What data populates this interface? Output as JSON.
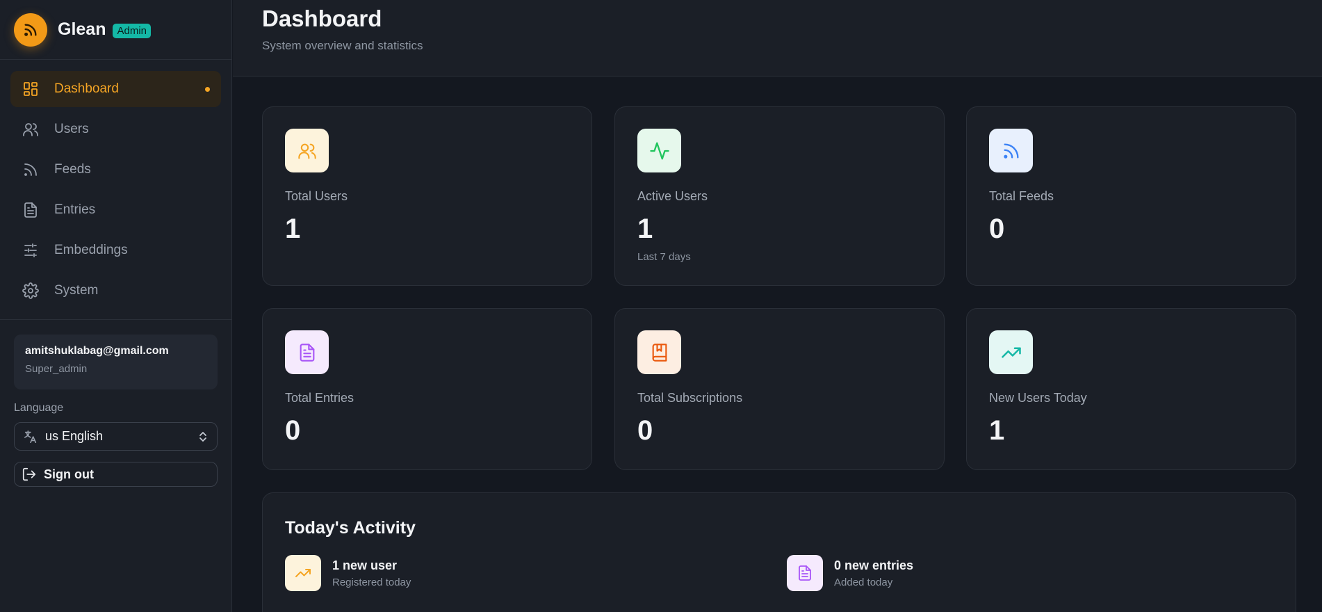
{
  "brand": {
    "name": "Glean",
    "badge": "Admin",
    "logo_icon": "rss-icon",
    "accent": "#f39a17"
  },
  "nav": {
    "items": [
      {
        "label": "Dashboard",
        "icon": "grid-icon",
        "active": true
      },
      {
        "label": "Users",
        "icon": "users-icon",
        "active": false
      },
      {
        "label": "Feeds",
        "icon": "rss-icon",
        "active": false
      },
      {
        "label": "Entries",
        "icon": "document-icon",
        "active": false
      },
      {
        "label": "Embeddings",
        "icon": "sliders-icon",
        "active": false
      },
      {
        "label": "System",
        "icon": "gear-icon",
        "active": false
      }
    ]
  },
  "user": {
    "email": "amitshuklabag@gmail.com",
    "role": "Super_admin"
  },
  "language": {
    "label": "Language",
    "value": "us English"
  },
  "signout": {
    "label": "Sign out"
  },
  "header": {
    "title": "Dashboard",
    "subtitle": "System overview and statistics"
  },
  "stats": [
    {
      "label": "Total Users",
      "value": "1",
      "note": "",
      "icon": "users-icon",
      "color": "#f5a524"
    },
    {
      "label": "Active Users",
      "value": "1",
      "note": "Last 7 days",
      "icon": "activity-icon",
      "color": "#22c55e"
    },
    {
      "label": "Total Feeds",
      "value": "0",
      "note": "",
      "icon": "rss-icon",
      "color": "#3b82f6"
    },
    {
      "label": "Total Entries",
      "value": "0",
      "note": "",
      "icon": "document-icon",
      "color": "#a855f7"
    },
    {
      "label": "Total Subscriptions",
      "value": "0",
      "note": "",
      "icon": "bookmark-book-icon",
      "color": "#ea580c"
    },
    {
      "label": "New Users Today",
      "value": "1",
      "note": "",
      "icon": "trending-up-icon",
      "color": "#14b8a6"
    }
  ],
  "activity": {
    "title": "Today's Activity",
    "items": [
      {
        "main": "1 new user",
        "sub": "Registered today",
        "icon": "trending-up-icon",
        "color": "#f5a524"
      },
      {
        "main": "0 new entries",
        "sub": "Added today",
        "icon": "document-icon",
        "color": "#a855f7"
      }
    ]
  }
}
